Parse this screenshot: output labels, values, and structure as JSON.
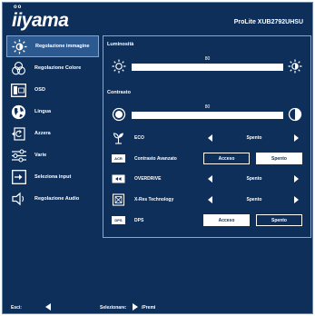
{
  "header": {
    "logo_marks": "oo",
    "logo": "iiyama",
    "model": "ProLite XUB2792UHSU"
  },
  "sidebar": {
    "items": [
      {
        "label": "Regolazione immagine",
        "icon": "sun-icon",
        "active": true
      },
      {
        "label": "Regolazione Colore",
        "icon": "color-circles-icon",
        "active": false
      },
      {
        "label": "OSD",
        "icon": "osd-icon",
        "active": false
      },
      {
        "label": "Lingua",
        "icon": "globe-icon",
        "active": false
      },
      {
        "label": "Azzera",
        "icon": "reset-icon",
        "active": false
      },
      {
        "label": "Varie",
        "icon": "sliders-icon",
        "active": false
      },
      {
        "label": "Seleziona input",
        "icon": "input-icon",
        "active": false
      },
      {
        "label": "Regolazione Audio",
        "icon": "speaker-icon",
        "active": false
      }
    ]
  },
  "panel": {
    "brightness": {
      "title": "Luminosità",
      "value": "80",
      "level": 0.8
    },
    "contrast": {
      "title": "Contrasto",
      "value": "80",
      "level": 0.8
    },
    "eco": {
      "label": "ECO",
      "value": "Spento"
    },
    "advanced_contrast": {
      "badge": "ACR",
      "label": "Contrasto Avanzato",
      "on": "Acceso",
      "off": "Spento",
      "selected": "off"
    },
    "overdrive": {
      "label": "OVERDRIVE",
      "value": "Spento"
    },
    "xres": {
      "label": "X-Res Technology",
      "value": "Spento"
    },
    "dps": {
      "badge": "DPS",
      "label": "DPS",
      "on": "Acceso",
      "off": "Spento",
      "selected": "off"
    }
  },
  "footer": {
    "exit": "Esci:",
    "select": "Selezionare:",
    "press": "/Premi"
  },
  "colors": {
    "background": "#0d2f5a",
    "active_item": "#2c5a90",
    "border": "#8ca6c8",
    "text": "#ffffff"
  }
}
